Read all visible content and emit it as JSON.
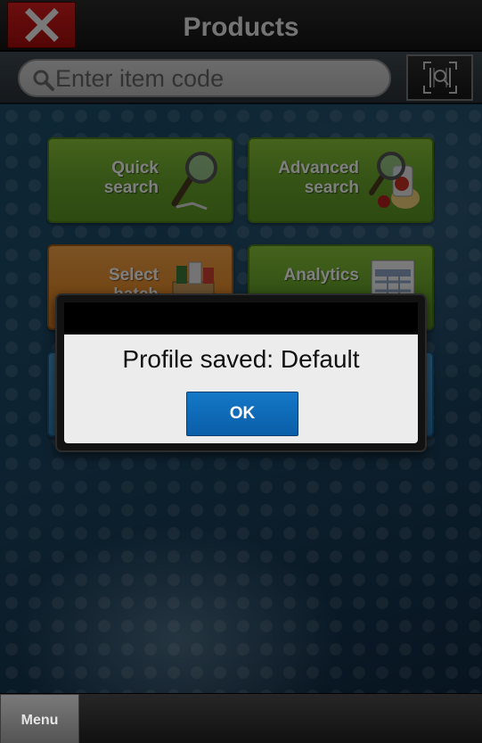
{
  "header": {
    "title": "Products",
    "close_icon": "close-icon",
    "close_color": "#c81414"
  },
  "search": {
    "placeholder": "Enter item code",
    "value": "",
    "search_icon": "search-icon",
    "scan_icon": "barcode-scan-icon"
  },
  "tiles": [
    {
      "label_line1": "Quick",
      "label_line2": "search",
      "icon": "magnifier-icon",
      "color": "#78b534"
    },
    {
      "label_line1": "Advanced",
      "label_line2": "search",
      "icon": "magnifier-products-icon",
      "color": "#78b534"
    },
    {
      "label_line1": "Select",
      "label_line2": "batch",
      "icon": "box-products-icon",
      "color": "#ef9a3a"
    },
    {
      "label_line1": "Analytics",
      "label_line2": "",
      "icon": "spreadsheet-icon",
      "color": "#78b534"
    }
  ],
  "dialog": {
    "message": "Profile saved: Default",
    "ok_label": "OK"
  },
  "bottom": {
    "menu_label": "Menu"
  }
}
